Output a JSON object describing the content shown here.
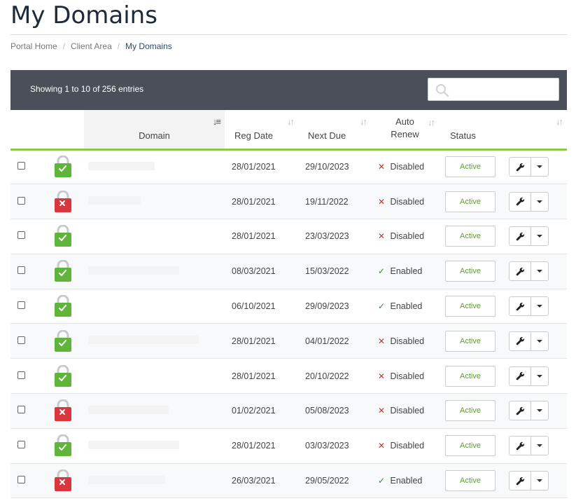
{
  "page": {
    "title": "My Domains"
  },
  "breadcrumb": [
    {
      "label": "Portal Home"
    },
    {
      "label": "Client Area"
    },
    {
      "label": "My Domains",
      "active": true
    }
  ],
  "toolbar": {
    "entries_info": "Showing 1 to 10 of 256 entries",
    "search_placeholder": ""
  },
  "table": {
    "columns": {
      "domain": "Domain",
      "reg_date": "Reg Date",
      "next_due": "Next Due",
      "auto_renew_line1": "Auto",
      "auto_renew_line2": "Renew",
      "status": "Status"
    },
    "rows": [
      {
        "locked": true,
        "reg_date": "28/01/2021",
        "next_due": "29/10/2023",
        "auto_renew": "Disabled",
        "status": "Active"
      },
      {
        "locked": false,
        "reg_date": "28/01/2021",
        "next_due": "19/11/2022",
        "auto_renew": "Disabled",
        "status": "Active"
      },
      {
        "locked": true,
        "reg_date": "28/01/2021",
        "next_due": "23/03/2023",
        "auto_renew": "Disabled",
        "status": "Active"
      },
      {
        "locked": true,
        "reg_date": "08/03/2021",
        "next_due": "15/03/2022",
        "auto_renew": "Enabled",
        "status": "Active"
      },
      {
        "locked": true,
        "reg_date": "06/10/2021",
        "next_due": "29/09/2023",
        "auto_renew": "Enabled",
        "status": "Active"
      },
      {
        "locked": true,
        "reg_date": "28/01/2021",
        "next_due": "04/01/2022",
        "auto_renew": "Disabled",
        "status": "Active"
      },
      {
        "locked": true,
        "reg_date": "28/01/2021",
        "next_due": "20/10/2022",
        "auto_renew": "Disabled",
        "status": "Active"
      },
      {
        "locked": false,
        "reg_date": "01/02/2021",
        "next_due": "05/08/2023",
        "auto_renew": "Disabled",
        "status": "Active"
      },
      {
        "locked": true,
        "reg_date": "28/01/2021",
        "next_due": "03/03/2023",
        "auto_renew": "Disabled",
        "status": "Active"
      },
      {
        "locked": false,
        "reg_date": "26/03/2021",
        "next_due": "29/05/2022",
        "auto_renew": "Enabled",
        "status": "Active"
      }
    ]
  },
  "colors": {
    "toolbar_bg": "#4a4f5a",
    "accent_green": "#8fc650",
    "lock_green": "#5fb53a",
    "lock_red": "#d9363e",
    "status_text": "#5aa02c"
  }
}
